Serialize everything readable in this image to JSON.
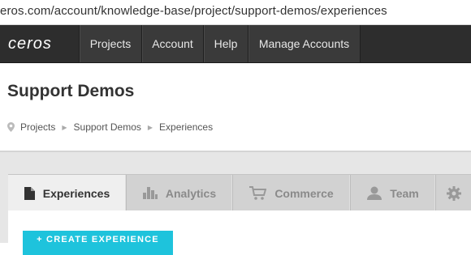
{
  "browser": {
    "url": "eros.com/account/knowledge-base/project/support-demos/experiences"
  },
  "nav": {
    "logo": "ceros",
    "items": [
      "Projects",
      "Account",
      "Help",
      "Manage Accounts"
    ]
  },
  "header": {
    "title": "Support Demos",
    "breadcrumb": [
      "Projects",
      "Support Demos",
      "Experiences"
    ]
  },
  "tabs": [
    {
      "label": "Experiences",
      "icon": "document-icon",
      "active": true
    },
    {
      "label": "Analytics",
      "icon": "bar-chart-icon",
      "active": false
    },
    {
      "label": "Commerce",
      "icon": "cart-icon",
      "active": false
    },
    {
      "label": "Team",
      "icon": "person-icon",
      "active": false
    },
    {
      "label": "",
      "icon": "gear-icon",
      "active": false
    }
  ],
  "actions": {
    "create_label": "+ CREATE EXPERIENCE"
  },
  "colors": {
    "accent": "#1ec3dc",
    "nav_bg": "#2d2d2d"
  }
}
